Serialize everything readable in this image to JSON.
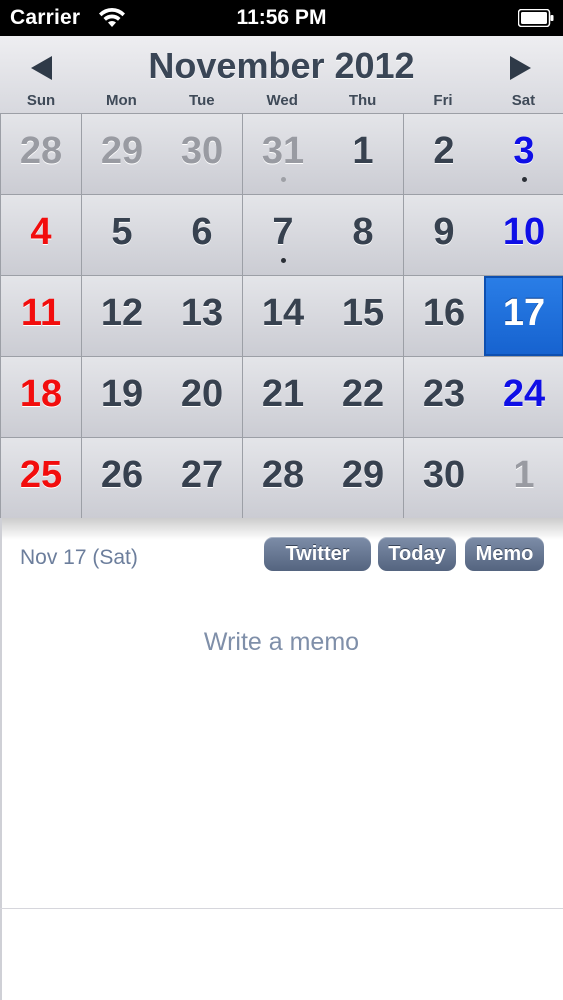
{
  "status_bar": {
    "carrier": "Carrier",
    "time": "11:56 PM",
    "icons": [
      "wifi-icon",
      "battery-icon"
    ]
  },
  "calendar": {
    "month_title": "November 2012",
    "nav": {
      "prev_icon": "triangle-left-icon",
      "next_icon": "triangle-right-icon"
    },
    "weekdays": [
      "Sun",
      "Mon",
      "Tue",
      "Wed",
      "Thu",
      "Fri",
      "Sat"
    ],
    "selected_day": "17",
    "weeks": [
      [
        {
          "d": "28",
          "other": true
        },
        {
          "d": "29",
          "other": true
        },
        {
          "d": "30",
          "other": true
        },
        {
          "d": "31",
          "other": true,
          "dot": true
        },
        {
          "d": "1"
        },
        {
          "d": "2"
        },
        {
          "d": "3",
          "dot": true
        }
      ],
      [
        {
          "d": "4"
        },
        {
          "d": "5"
        },
        {
          "d": "6"
        },
        {
          "d": "7",
          "dot": true
        },
        {
          "d": "8"
        },
        {
          "d": "9"
        },
        {
          "d": "10"
        }
      ],
      [
        {
          "d": "11"
        },
        {
          "d": "12"
        },
        {
          "d": "13"
        },
        {
          "d": "14"
        },
        {
          "d": "15"
        },
        {
          "d": "16"
        },
        {
          "d": "17",
          "selected": true
        }
      ],
      [
        {
          "d": "18"
        },
        {
          "d": "19"
        },
        {
          "d": "20"
        },
        {
          "d": "21"
        },
        {
          "d": "22"
        },
        {
          "d": "23"
        },
        {
          "d": "24"
        }
      ],
      [
        {
          "d": "25"
        },
        {
          "d": "26"
        },
        {
          "d": "27"
        },
        {
          "d": "28"
        },
        {
          "d": "29"
        },
        {
          "d": "30"
        },
        {
          "d": "1",
          "other": true
        }
      ]
    ],
    "colors": {
      "sunday": "#f20d0d",
      "saturday": "#0f0fe6",
      "selected": "#1f6fdc",
      "other_month": "#999ba2"
    }
  },
  "day_panel": {
    "date_label": "Nov 17 (Sat)",
    "twitter_label": "Twitter",
    "today_label": "Today",
    "memo_label": "Memo",
    "memo_placeholder": "Write a memo"
  }
}
